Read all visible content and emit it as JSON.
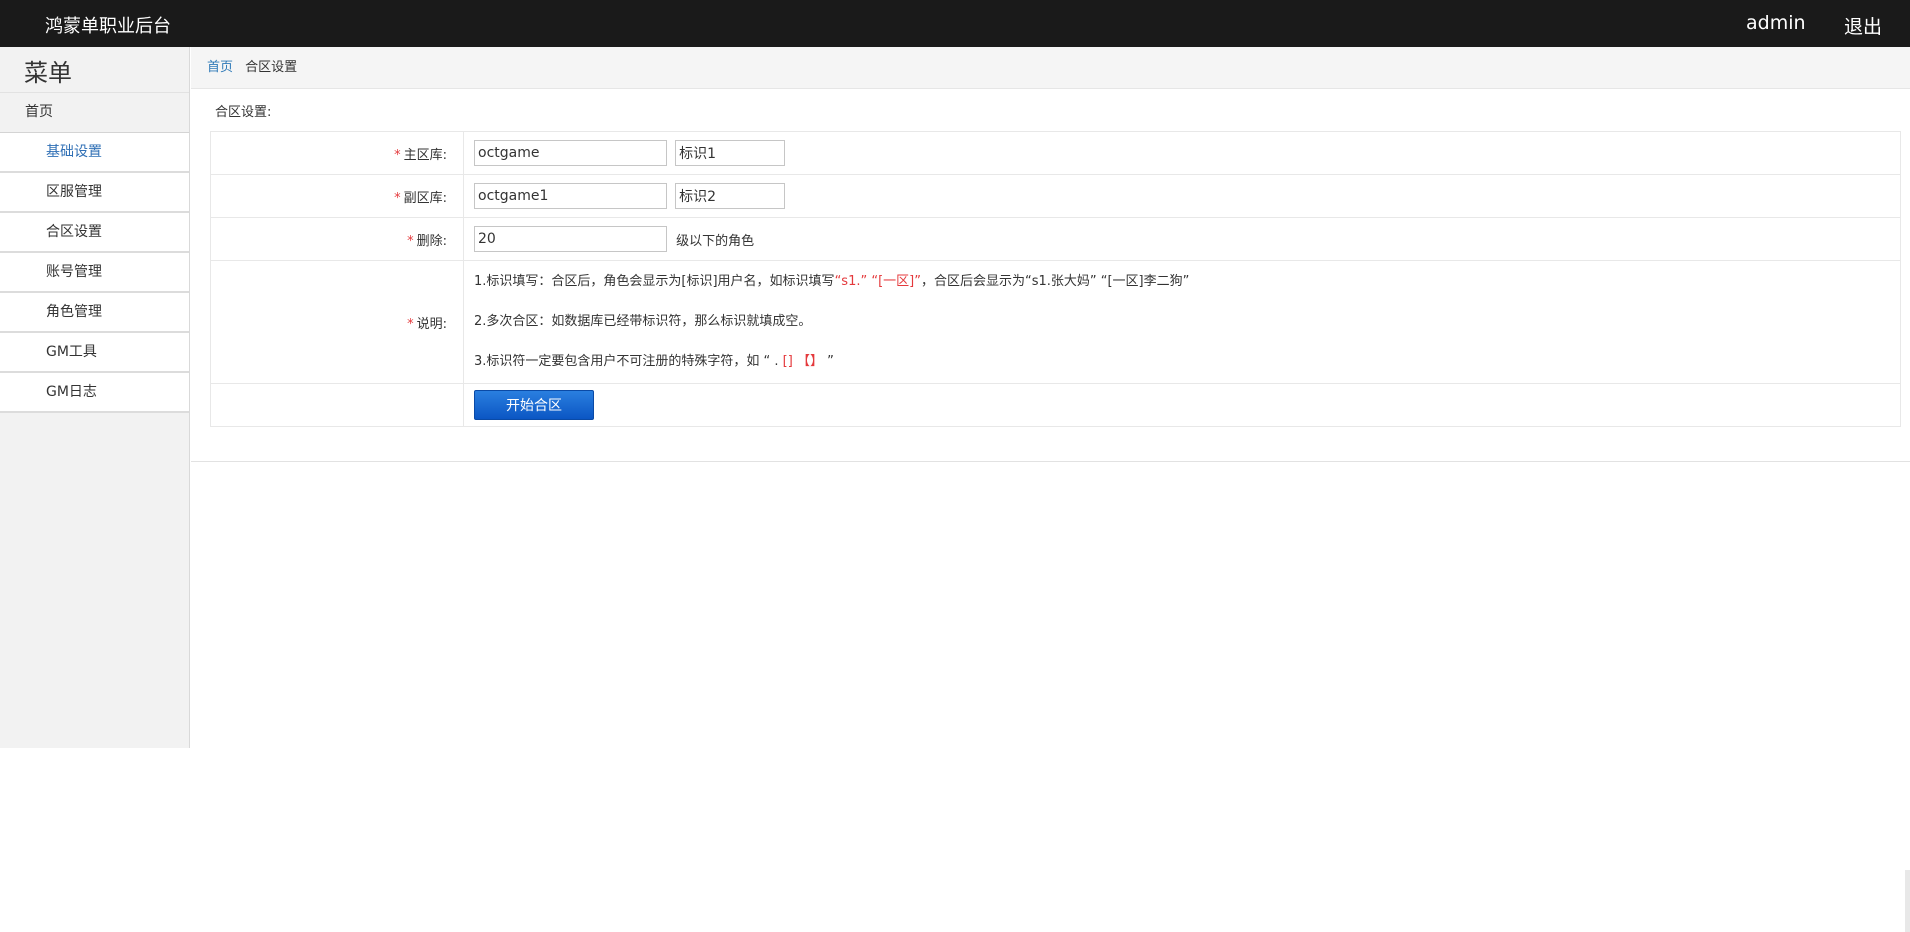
{
  "header": {
    "brand": "鸿蒙单职业后台",
    "user": "admin",
    "logout": "退出"
  },
  "sidebar": {
    "title": "菜单",
    "home": "首页",
    "items": [
      {
        "label": "基础设置"
      },
      {
        "label": "区服管理"
      },
      {
        "label": "合区设置"
      },
      {
        "label": "账号管理"
      },
      {
        "label": "角色管理"
      },
      {
        "label": "GM工具"
      },
      {
        "label": "GM日志"
      }
    ]
  },
  "breadcrumb": {
    "home": "首页",
    "current": "合区设置"
  },
  "form": {
    "section_title": "合区设置:",
    "required_mark": "*",
    "main_db": {
      "label": "主区库:",
      "db_value": "octgame",
      "tag_value": "标识1"
    },
    "sub_db": {
      "label": "副区库:",
      "db_value": "octgame1",
      "tag_value": "标识2"
    },
    "delete": {
      "label": "删除:",
      "value": "20",
      "suffix": "级以下的角色"
    },
    "desc": {
      "label": "说明:",
      "line1_a": "1.标识填写：合区后，角色会显示为[标识]用户名，如标识填写",
      "line1_red": "“s1.” “[一区]”",
      "line1_b": "，合区后会显示为“s1.张大妈” “[一区]李二狗”",
      "line2": "2.多次合区：如数据库已经带标识符，那么标识就填成空。",
      "line3_a": "3.标识符一定要包含用户不可注册的特殊字符，如 “ .",
      "line3_red": " [] 【】",
      "line3_b": " ”"
    },
    "submit": "开始合区"
  }
}
